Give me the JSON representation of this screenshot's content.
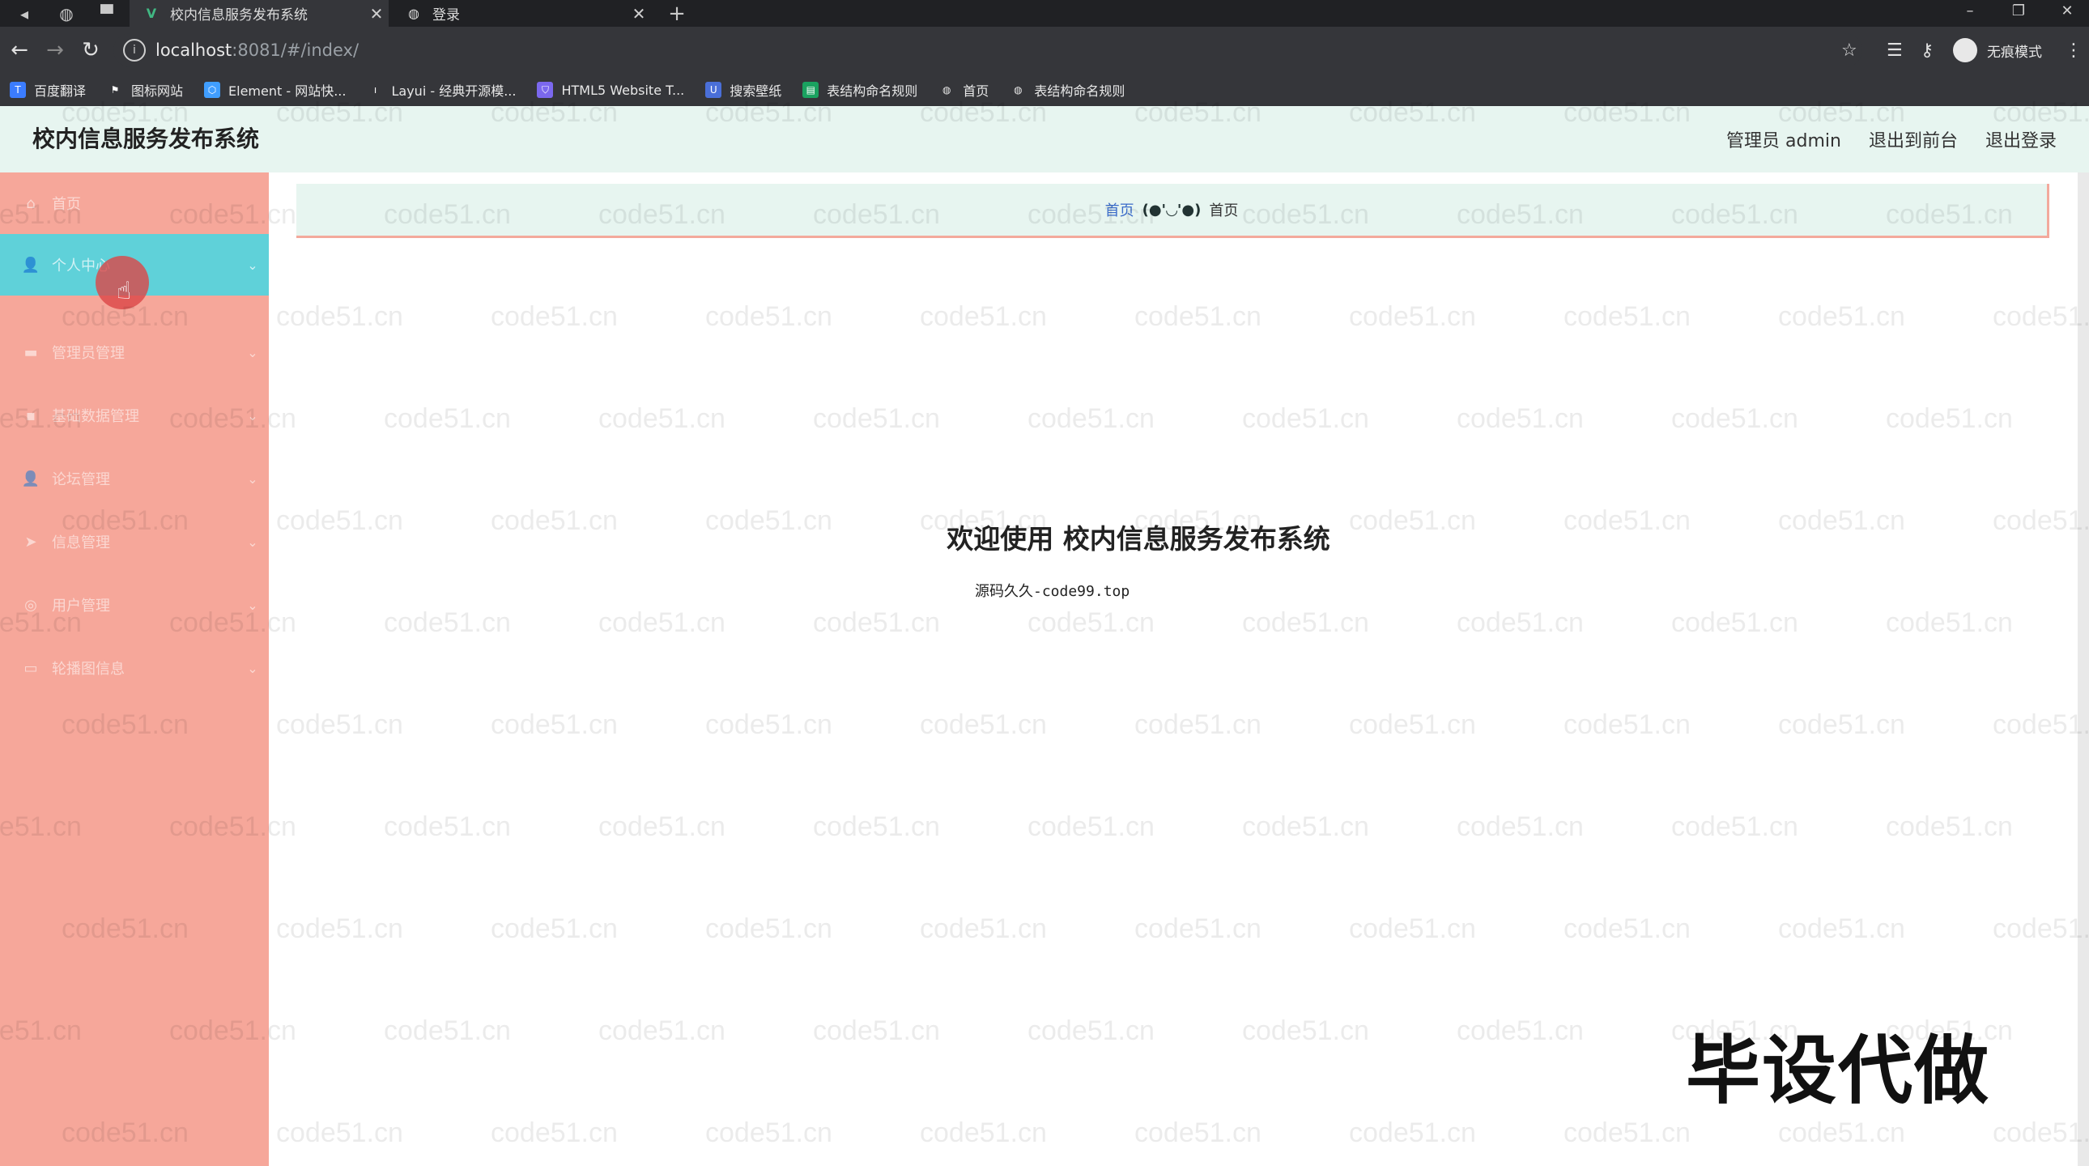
{
  "browser": {
    "tabs": [
      {
        "title": "校内信息服务发布系统",
        "active": true
      },
      {
        "title": "登录",
        "active": false
      }
    ],
    "url_host": "localhost",
    "url_rest": ":8081/#/index/",
    "incognito_label": "无痕模式",
    "bookmarks": [
      {
        "label": "百度翻译",
        "color": "#3b7cff"
      },
      {
        "label": "图标网站",
        "color": "#e8e8e8"
      },
      {
        "label": "Element - 网站快...",
        "color": "#409eff"
      },
      {
        "label": "Layui - 经典开源模...",
        "color": "#5e5e5e"
      },
      {
        "label": "HTML5 Website T...",
        "color": "#7b68ee"
      },
      {
        "label": "搜索壁纸",
        "color": "#4a6fd8"
      },
      {
        "label": "表结构命名规则",
        "color": "#1aa260"
      },
      {
        "label": "首页",
        "color": "#777777"
      },
      {
        "label": "表结构命名规则",
        "color": "#777777"
      }
    ]
  },
  "header": {
    "title": "校内信息服务发布系统",
    "user": "管理员 admin",
    "to_front": "退出到前台",
    "logout": "退出登录"
  },
  "sidebar": {
    "items": [
      {
        "label": "首页",
        "icon": "home-icon",
        "active": false
      },
      {
        "label": "个人中心",
        "icon": "user-icon",
        "active": true
      },
      {
        "label": "管理员管理",
        "icon": "admin-icon",
        "active": false
      },
      {
        "label": "基础数据管理",
        "icon": "database-icon",
        "active": false
      },
      {
        "label": "论坛管理",
        "icon": "forum-icon",
        "active": false
      },
      {
        "label": "信息管理",
        "icon": "send-icon",
        "active": false
      },
      {
        "label": "用户管理",
        "icon": "users-icon",
        "active": false
      },
      {
        "label": "轮播图信息",
        "icon": "image-icon",
        "active": false
      }
    ],
    "accent_color": "#5fd1d9",
    "background_color": "#f6a79a"
  },
  "breadcrumb": {
    "home": "首页",
    "separator": "(●'◡'●)",
    "current": "首页"
  },
  "main": {
    "welcome": "欢迎使用 校内信息服务发布系统",
    "subline": "源码久久-code99.top"
  },
  "watermark_text": "code51.cn",
  "stamp_text": "毕设代做"
}
